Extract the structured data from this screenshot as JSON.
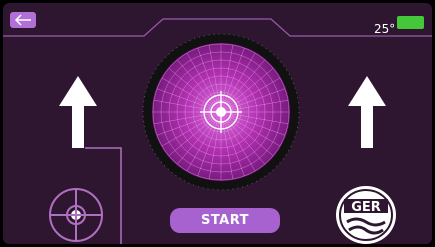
{
  "header": {
    "back_icon": "arrow-left-icon",
    "temperature": "25°",
    "battery_icon": "battery-icon",
    "battery_color": "#44c83a"
  },
  "main": {
    "left_arrow_icon": "arrow-up-icon",
    "right_arrow_icon": "arrow-up-icon",
    "radar_icon": "radar-scope-icon",
    "start_label": "START"
  },
  "footer": {
    "target_icon": "crosshair-icon",
    "brand": {
      "text": "GER",
      "icon": "ger-logo"
    }
  },
  "colors": {
    "background": "#2e1530",
    "accent": "#b070d8",
    "radar_purple": "#b040b8",
    "line": "#c79ad8"
  }
}
